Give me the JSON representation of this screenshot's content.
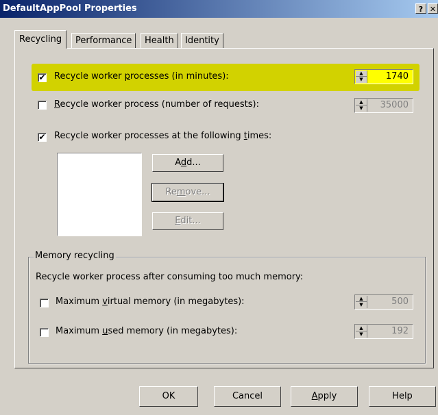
{
  "window": {
    "title": "DefaultAppPool Properties",
    "help_btn": "?",
    "close_btn": "✕"
  },
  "tabs": [
    {
      "label": "Recycling",
      "active": true
    },
    {
      "label": "Performance",
      "active": false
    },
    {
      "label": "Health",
      "active": false
    },
    {
      "label": "Identity",
      "active": false
    }
  ],
  "recycling": {
    "minutes": {
      "label_pre": "Recycle worker ",
      "label_u": "p",
      "label_post": "rocesses (in minutes):",
      "checked": true,
      "value": "1740",
      "highlighted_color": "#d2d200"
    },
    "requests": {
      "label_pre": "",
      "label_u": "R",
      "label_post": "ecycle worker process (number of requests):",
      "checked": false,
      "value": "35000"
    },
    "times": {
      "label_pre": "Recycle worker processes at the following ",
      "label_u": "t",
      "label_post": "imes:",
      "checked": true
    },
    "buttons": {
      "add": {
        "pre": "A",
        "u": "d",
        "post": "d..."
      },
      "remove": {
        "pre": "Re",
        "u": "m",
        "post": "ove..."
      },
      "edit": {
        "pre": "",
        "u": "E",
        "post": "dit..."
      }
    }
  },
  "memory": {
    "group_title": "Memory recycling",
    "description": "Recycle worker process after consuming too much memory:",
    "virtual": {
      "label_pre": "Maximum ",
      "label_u": "v",
      "label_post": "irtual memory (in megabytes):",
      "checked": false,
      "value": "500"
    },
    "used": {
      "label_pre": "Maximum ",
      "label_u": "u",
      "label_post": "sed memory (in megabytes):",
      "checked": false,
      "value": "192"
    }
  },
  "footer": {
    "ok": "OK",
    "cancel": "Cancel",
    "apply": {
      "pre": "",
      "u": "A",
      "post": "pply"
    },
    "help": "Help"
  },
  "icons": {
    "check": "✔",
    "spin_up": "▲",
    "spin_down": "▼"
  }
}
